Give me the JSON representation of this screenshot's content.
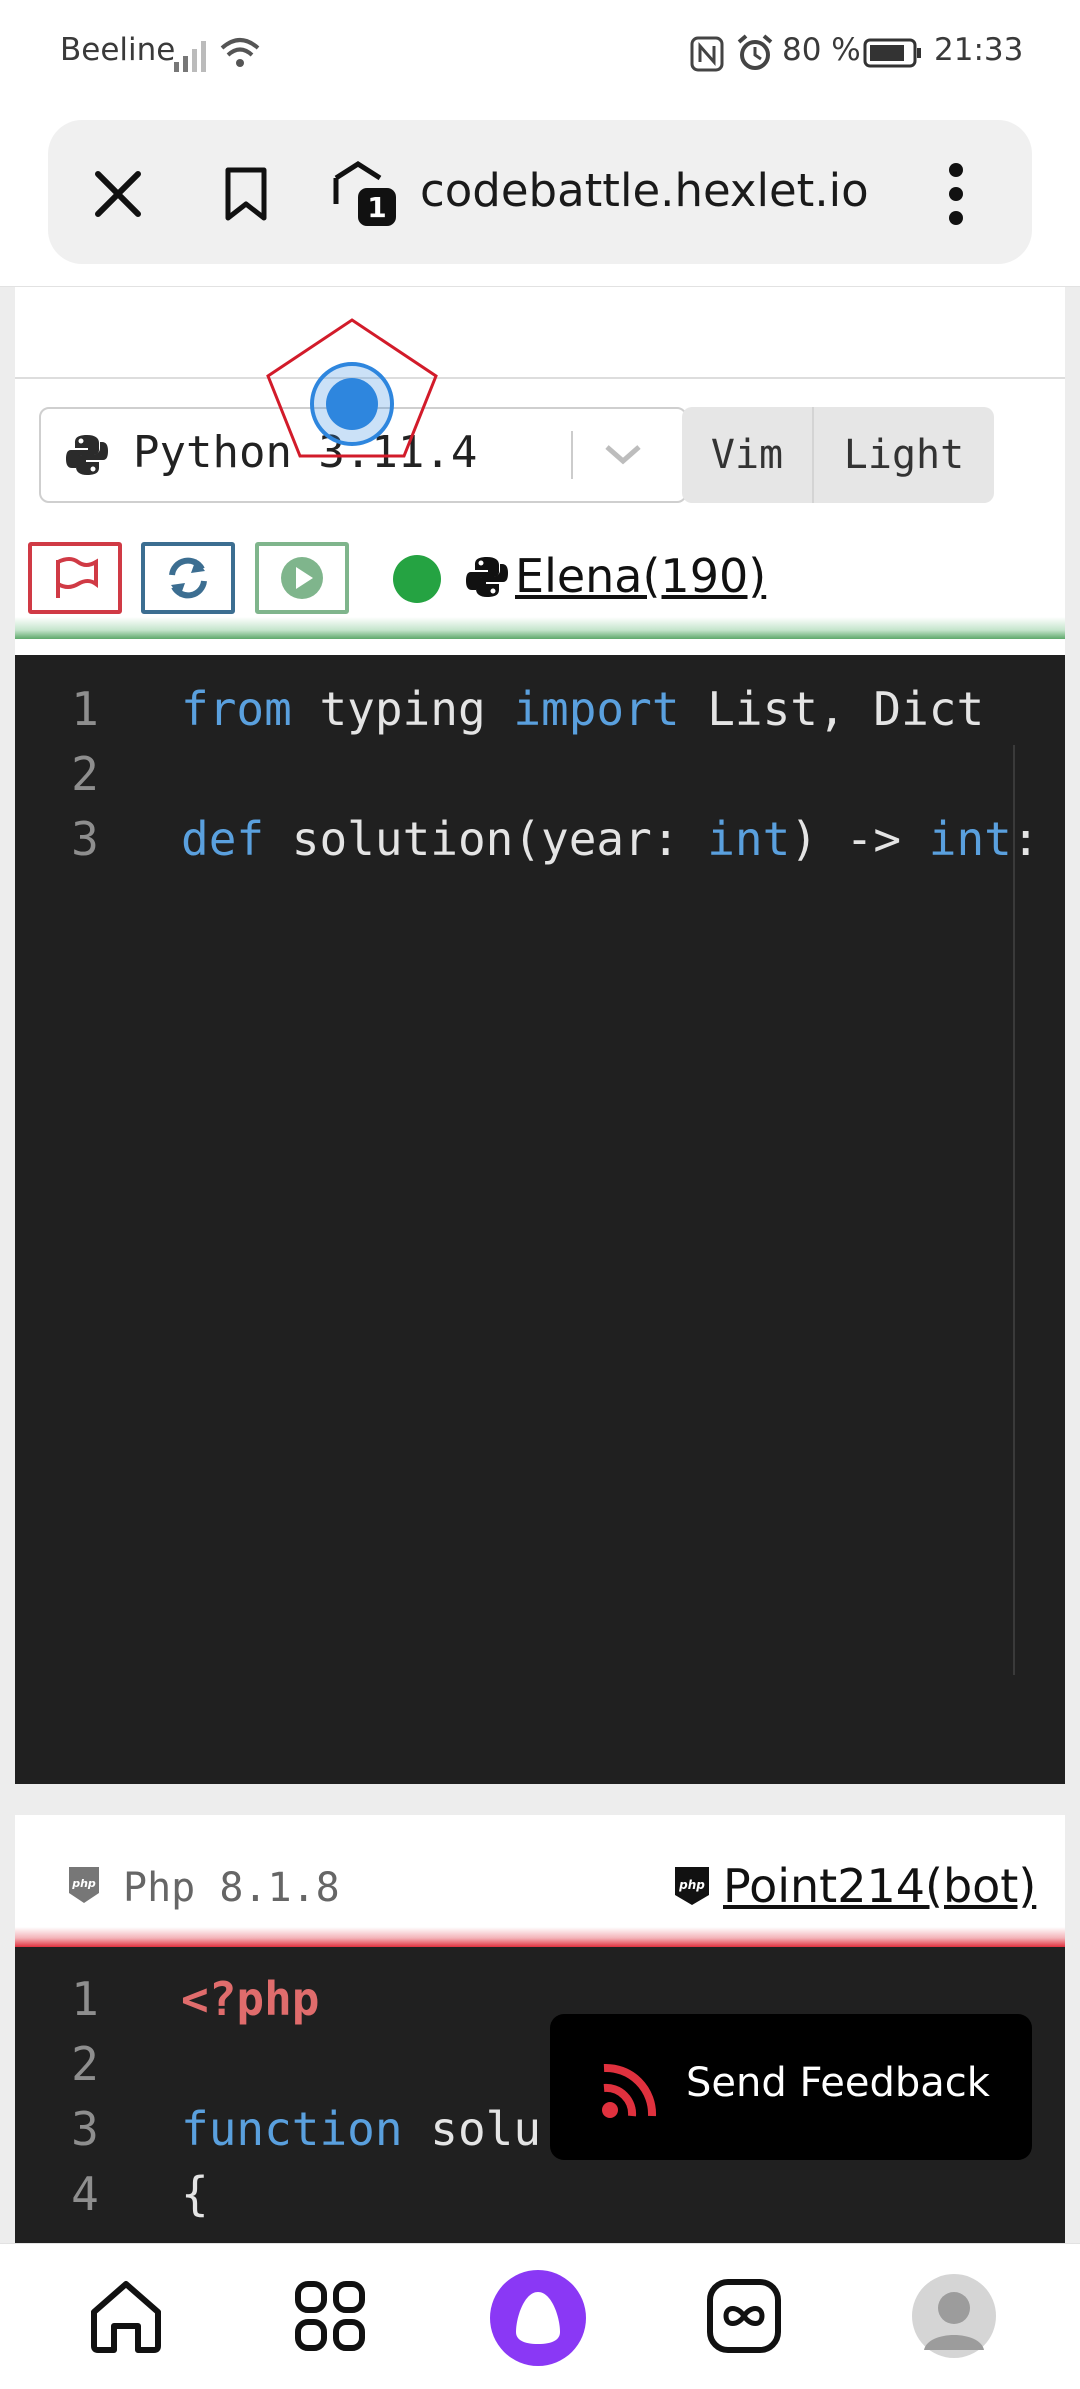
{
  "status_bar": {
    "carrier": "Beeline",
    "battery": "80 %",
    "time": "21:33"
  },
  "browser": {
    "url": "codebattle.hexlet.io",
    "tab_count": "1"
  },
  "editor": {
    "language": "Python 3.11.4",
    "keymap_label": "Vim",
    "theme_label": "Light",
    "player": "Elena(190)",
    "code_lines": [
      {
        "n": "1",
        "tokens": [
          {
            "t": "from",
            "c": "kw"
          },
          {
            "t": " typing ",
            "c": ""
          },
          {
            "t": "import",
            "c": "kw"
          },
          {
            "t": " List, Dict",
            "c": ""
          }
        ]
      },
      {
        "n": "2",
        "tokens": []
      },
      {
        "n": "3",
        "tokens": [
          {
            "t": "def",
            "c": "kw"
          },
          {
            "t": " solution(year: ",
            "c": ""
          },
          {
            "t": "int",
            "c": "kw"
          },
          {
            "t": ") -> ",
            "c": ""
          },
          {
            "t": "int",
            "c": "kw"
          },
          {
            "t": ":",
            "c": ""
          }
        ]
      }
    ]
  },
  "opponent": {
    "language": "Php 8.1.8",
    "player": "Point214(bot)",
    "code_lines": [
      {
        "n": "1",
        "tokens": [
          {
            "t": "<?php",
            "c": "php"
          }
        ]
      },
      {
        "n": "2",
        "tokens": []
      },
      {
        "n": "3",
        "tokens": [
          {
            "t": "function",
            "c": "kw"
          },
          {
            "t": " solu",
            "c": ""
          }
        ]
      },
      {
        "n": "4",
        "tokens": [
          {
            "t": "{",
            "c": ""
          }
        ]
      }
    ]
  },
  "feedback": {
    "label": "Send Feedback"
  },
  "colors": {
    "give_up": "#d03a45",
    "reset": "#3c6e91",
    "run": "#7fb58c",
    "online": "#25a342",
    "opponent_bar": "#e0313e"
  },
  "icons": [
    "close-icon",
    "bookmark-icon",
    "tabs-icon",
    "more-icon",
    "python-icon",
    "chevron-down-icon",
    "flag-icon",
    "refresh-icon",
    "play-icon",
    "php-icon",
    "rss-icon",
    "home-icon",
    "apps-icon",
    "assistant-icon",
    "infinity-icon",
    "avatar-icon"
  ]
}
